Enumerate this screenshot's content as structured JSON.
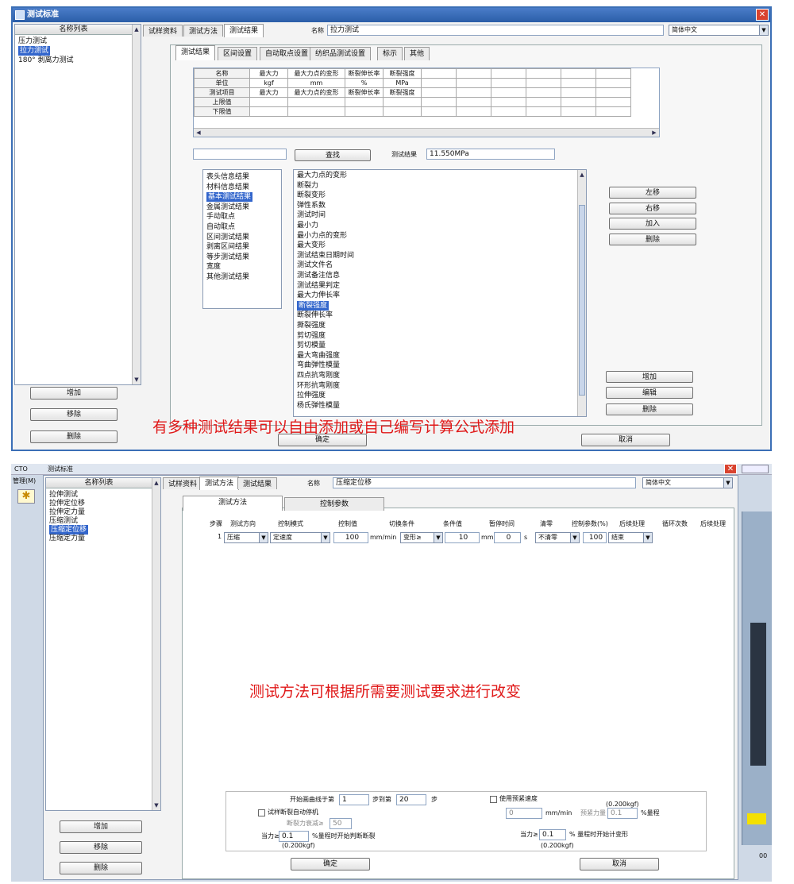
{
  "win1": {
    "title": "测试标准",
    "close": "✕",
    "left_header": "名称列表",
    "left_items": [
      "压力测试",
      "拉力测试",
      "180° 剥离力测试"
    ],
    "left_selected": 1,
    "left_buttons": [
      "增加",
      "移除",
      "删除"
    ],
    "tabs": [
      "试样资料",
      "测试方法",
      "测试结果"
    ],
    "name_label": "名称",
    "name_value": "拉力测试",
    "language": "简体中文",
    "inner_tabs": [
      "测试结果",
      "区间设置",
      "自动取点设置",
      "纺织品测试设置",
      "标示",
      "其他"
    ],
    "grid_rows": [
      [
        "名称",
        "最大力",
        "最大力点的变形",
        "断裂伸长率",
        "断裂强度"
      ],
      [
        "单位",
        "kgf",
        "mm",
        "%",
        "MPa"
      ],
      [
        "测试项目",
        "最大力",
        "最大力点的变形",
        "断裂伸长率",
        "断裂强度"
      ],
      [
        "上限值",
        "",
        "",
        "",
        ""
      ],
      [
        "下限值",
        "",
        "",
        "",
        ""
      ]
    ],
    "find_button": "查找",
    "result_label": "测试结果",
    "result_value": "11.550MPa",
    "categories": [
      "表头信息结果",
      "材料信息结果",
      "基本测试结果",
      "金属测试结果",
      "手动取点",
      "自动取点",
      "区间测试结果",
      "剥离区间结果",
      "等步测试结果",
      "宽度",
      "其他测试结果"
    ],
    "category_selected": 2,
    "results": [
      "最大力点的变形",
      "断裂力",
      "断裂变形",
      "弹性系数",
      "测试时间",
      "最小力",
      "最小力点的变形",
      "最大变形",
      "测试结束日期时间",
      "测试文件名",
      "测试备注信息",
      "测试结果判定",
      "最大力伸长率",
      "断裂强度",
      "断裂伸长率",
      "撕裂强度",
      "剪切强度",
      "剪切模量",
      "最大弯曲强度",
      "弯曲弹性模量",
      "四点抗弯刚度",
      "环形抗弯刚度",
      "拉伸强度",
      "杨氏弹性模量"
    ],
    "result_selected": 13,
    "move_buttons": [
      "左移",
      "右移",
      "加入",
      "删除"
    ],
    "edit_buttons": [
      "增加",
      "编辑",
      "删除"
    ],
    "caption": "有多种测试结果可以自由添加或自己编写计算公式添加",
    "ok": "确定",
    "cancel": "取消"
  },
  "win2": {
    "title": "测试标准",
    "behind_title": "CTO",
    "menu": "管理(M)",
    "left_header": "名称列表",
    "left_items": [
      "拉伸测试",
      "拉伸定位移",
      "拉伸定力量",
      "压缩测试",
      "压缩定位移",
      "压缩定力量"
    ],
    "left_selected": 4,
    "left_buttons": [
      "增加",
      "移除",
      "删除"
    ],
    "tabs": [
      "试样资料",
      "测试方法",
      "测试结果"
    ],
    "name_label": "名称",
    "name_value": "压缩定位移",
    "language": "简体中文",
    "inner_tabs": [
      "测试方法",
      "控制参数"
    ],
    "headers": [
      "步骤",
      "测试方向",
      "控制模式",
      "控制值",
      "切换条件",
      "条件值",
      "暂停时间",
      "清零",
      "控制参数(%)",
      "后续处理",
      "循环次数",
      "后续处理"
    ],
    "row": {
      "step": "1",
      "direction": "压缩",
      "mode": "定速度",
      "value": "100",
      "unit": "mm/min",
      "condition": "变形≥",
      "cond_value": "10",
      "cond_unit": "mm",
      "pause": "0",
      "pause_unit": "s",
      "zero": "不清零",
      "param": "100",
      "after": "结束"
    },
    "caption": "测试方法可根据所需要测试要求进行改变",
    "curve_start_label": "开始画曲线于第",
    "curve_start": "1",
    "curve_to_label": "步到第",
    "curve_end": "20",
    "curve_end_label": "步",
    "preload_label": "使用预紧速度",
    "preload_unit_top": "(0.200kgf)",
    "preload_speed": "0",
    "preload_speed_unit": "mm/min",
    "preload_force_label": "预紧力量",
    "preload_force": "0.1",
    "preload_force_unit": "%量程",
    "break_stop_label": "试样断裂自动停机",
    "break_decay_label": "断裂力衰减≥",
    "break_decay": "50",
    "force_label": "当力≥",
    "force_value": "0.1",
    "force_desc": "%量程时开始判断断裂",
    "force_unit": "(0.200kgf)",
    "force2_label": "当力≥",
    "force2_value": "0.1",
    "force2_desc": "% 量程时开始计变形",
    "force2_unit": "(0.200kgf)",
    "ok": "确定",
    "cancel": "取消",
    "star": "✱",
    "right_edge": "00"
  },
  "colors": {
    "accent": "#3366cc",
    "caption": "#e01818",
    "title": "#2b5ea8"
  }
}
